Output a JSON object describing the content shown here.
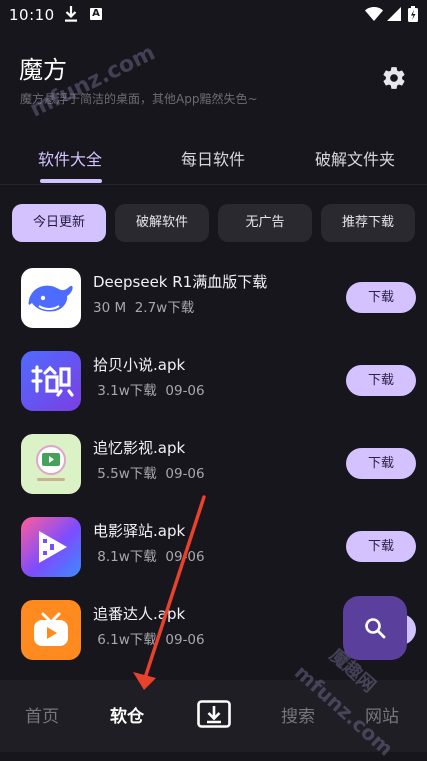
{
  "status_bar": {
    "time": "10:10",
    "badge": "A"
  },
  "header": {
    "title": "魔方",
    "subtitle": "魔方悬浮于简洁的桌面，其他App黯然失色~"
  },
  "tabs": [
    {
      "label": "软件大全",
      "active": true
    },
    {
      "label": "每日软件",
      "active": false
    },
    {
      "label": "破解文件夹",
      "active": false
    }
  ],
  "chips": [
    {
      "label": "今日更新",
      "active": true
    },
    {
      "label": "破解软件",
      "active": false
    },
    {
      "label": "无广告",
      "active": false
    },
    {
      "label": "推荐下载",
      "active": false
    }
  ],
  "apps": [
    {
      "name": "Deepseek R1满血版下载",
      "meta": "30 M  2.7w下载",
      "button": "下载",
      "icon": "deepseek-whale-icon"
    },
    {
      "name": "拾贝小说.apk",
      "meta": " 3.1w下载  09-06",
      "button": "下载",
      "icon": "shibei-novel-icon"
    },
    {
      "name": "追忆影视.apk",
      "meta": " 5.5w下载  09-06",
      "button": "下载",
      "icon": "zhuiyi-video-icon"
    },
    {
      "name": "电影驿站.apk",
      "meta": " 8.1w下载  09-06",
      "button": "下载",
      "icon": "movie-station-icon"
    },
    {
      "name": "追番达人.apk",
      "meta": " 6.1w下载  09-06",
      "button": "下载",
      "icon": "zhuifan-tv-icon"
    }
  ],
  "bottom_nav": [
    {
      "label": "首页",
      "active": false
    },
    {
      "label": "软仓",
      "active": true
    },
    {
      "label": "搜索",
      "active": false
    },
    {
      "label": "网站",
      "active": false
    }
  ],
  "watermarks": [
    "mfunz.com",
    "魔趣网",
    "mfunz.com"
  ],
  "colors": {
    "accent": "#d3c2ff",
    "background": "#17161c",
    "fab": "#5b3f9c",
    "annotation_arrow": "#e8412c"
  }
}
